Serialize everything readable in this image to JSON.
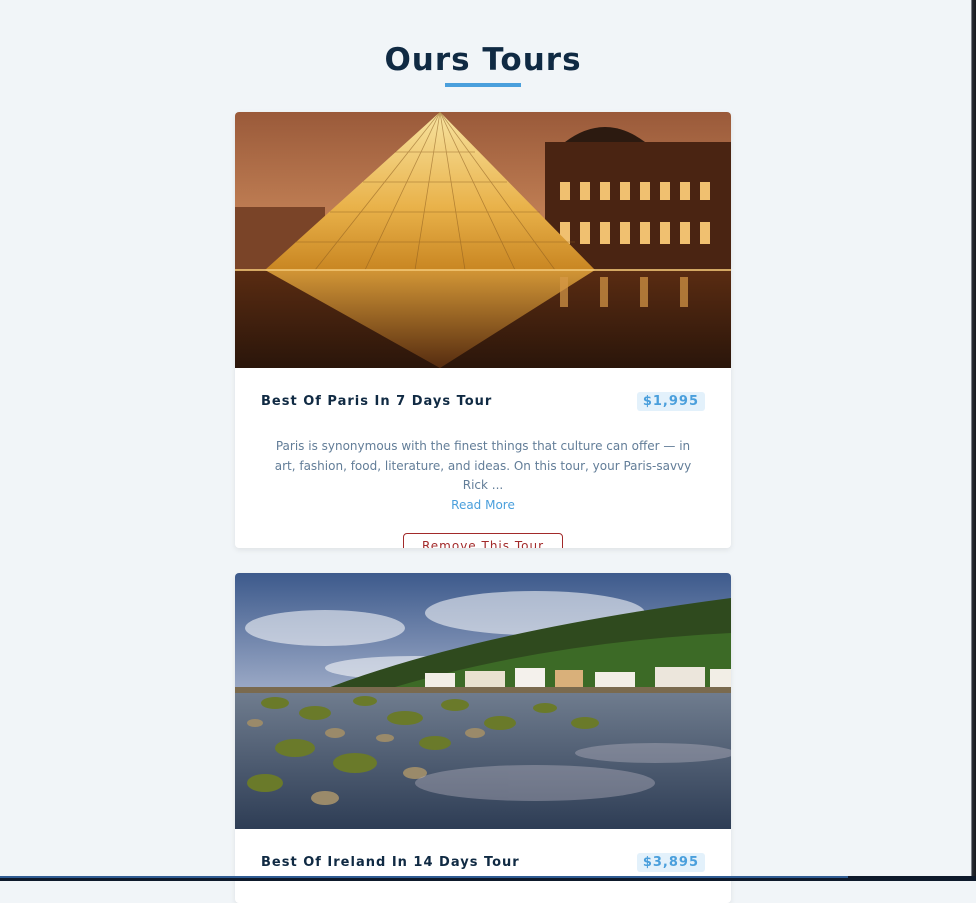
{
  "page": {
    "title": "Ours Tours"
  },
  "tours": [
    {
      "name": "Best Of Paris In 7 Days Tour",
      "price": "$1,995",
      "description": "Paris is synonymous with the finest things that culture can offer — in art, fashion, food, literature, and ideas. On this tour, your Paris-savvy Rick ...",
      "read_more_label": "Read More",
      "remove_label": "Remove This Tour",
      "image_label": "Louvre pyramid at night"
    },
    {
      "name": "Best Of Ireland In 14 Days Tour",
      "price": "$3,895",
      "image_label": "Irish coastal village with mossy rocks"
    }
  ],
  "colors": {
    "title": "#102a43",
    "accent": "#4a9fdc",
    "danger": "#a22a2a",
    "background": "#f1f5f8"
  }
}
